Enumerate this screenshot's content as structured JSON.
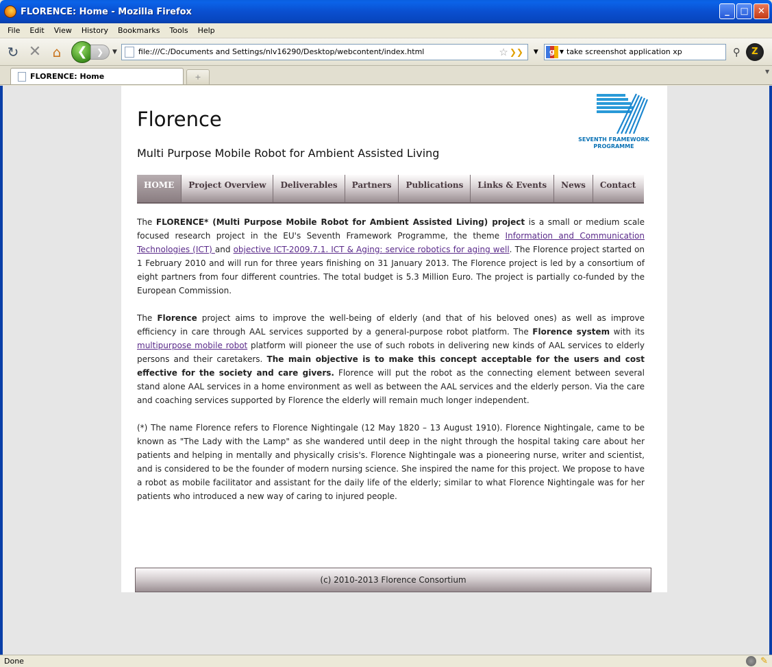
{
  "window": {
    "title": "FLORENCE: Home - Mozilla Firefox",
    "buttons": {
      "minimize": "_",
      "maximize": "□",
      "close": "✕"
    }
  },
  "menubar": {
    "items": [
      "File",
      "Edit",
      "View",
      "History",
      "Bookmarks",
      "Tools",
      "Help"
    ]
  },
  "navbar": {
    "url": "file:///C:/Documents and Settings/nlv16290/Desktop/webcontent/index.html",
    "search": {
      "value": "take screenshot application xp"
    }
  },
  "tabs": {
    "items": [
      {
        "label": "FLORENCE: Home"
      }
    ],
    "newtab_label": "+"
  },
  "page": {
    "title": "Florence",
    "subtitle": "Multi Purpose Mobile Robot for Ambient Assisted Living",
    "logo": {
      "line1": "SEVENTH FRAMEWORK",
      "line2": "PROGRAMME"
    },
    "nav": {
      "items": [
        {
          "label": "HOME",
          "active": true
        },
        {
          "label": "Project Overview"
        },
        {
          "label": "Deliverables"
        },
        {
          "label": "Partners"
        },
        {
          "label": "Publications"
        },
        {
          "label": "Links & Events"
        },
        {
          "label": "News"
        },
        {
          "label": "Contact"
        }
      ]
    },
    "content": {
      "p1": {
        "t1": "The ",
        "b1": "FLORENCE* (Multi Purpose Mobile Robot for Ambient Assisted Living) project",
        "t2": " is a small or medium scale focused research project in the EU's Seventh Framework Programme, the theme ",
        "link1": "Information and Communication Technologies (ICT) ",
        "t3": "and ",
        "link2": "objective ICT-2009.7.1. ICT & Aging: service robotics for aging well",
        "t4": ". The Florence project started on 1 February 2010 and will run for three years finishing on 31 January 2013. The Florence project is led by a consortium of eight partners from four different countries. The total budget is 5.3 Million Euro. The project is partially co-funded by the European Commission."
      },
      "p2": {
        "t1": "The ",
        "b1": "Florence",
        "t2": " project aims to improve the well-being of elderly (and that of his beloved ones) as well as improve efficiency in care through AAL services supported by a general-purpose robot platform. The ",
        "b2": "Florence system",
        "t3": " with its ",
        "link1": "multipurpose mobile robot",
        "t4": " platform will pioneer the use of such robots in delivering new kinds of AAL services to elderly persons and their caretakers. ",
        "b3": "The main objective is to make this concept acceptable for the users and cost effective for the society and care givers.",
        "t5": " Florence will put the robot as the connecting element between several stand alone AAL services in a home environment as well as between the AAL services and the elderly person. Via the care and coaching services supported by Florence the elderly will remain much longer independent."
      },
      "p3": "(*) The name Florence refers to Florence Nightingale (12 May 1820 – 13 August 1910). Florence Nightingale, came to be known as \"The Lady with the Lamp\" as she wandered until deep in the night through the hospital taking care about her patients and helping in mentally and physically crisis's. Florence Nightingale was a pioneering nurse, writer and scientist, and is considered to be the founder of modern nursing science. She inspired the name for this project. We propose to have a robot as mobile facilitator and assistant for the daily life of the elderly; similar to what Florence Nightingale was for her patients who introduced a new way of caring to injured people."
    },
    "footer": "(c) 2010-2013 Florence Consortium"
  },
  "statusbar": {
    "text": "Done"
  },
  "colors": {
    "titlebar": "#0a4fd0",
    "nav_active": "#8a7d81",
    "link": "#5a2a8a",
    "fp7_blue": "#0a72b5"
  },
  "icons": [
    "firefox-icon",
    "reload-icon",
    "stop-icon",
    "home-icon",
    "back-icon",
    "forward-icon",
    "page-icon",
    "bookmark-star-icon",
    "rss-icon",
    "google-icon",
    "magnifier-icon",
    "addon-icon"
  ]
}
